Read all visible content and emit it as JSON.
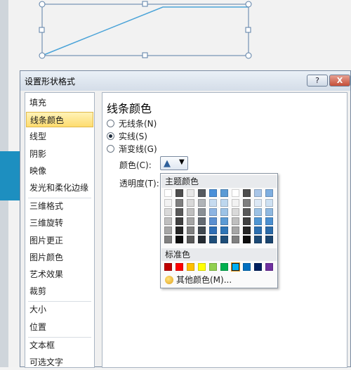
{
  "dialog": {
    "title": "设置形状格式",
    "help_label": "?",
    "close_label": "X"
  },
  "categories": [
    {
      "label": "填充"
    },
    {
      "label": "线条颜色",
      "selected": true
    },
    {
      "label": "线型"
    },
    {
      "label": "阴影"
    },
    {
      "label": "映像"
    },
    {
      "label": "发光和柔化边缘"
    },
    {
      "label": "三维格式"
    },
    {
      "label": "三维旋转"
    },
    {
      "label": "图片更正"
    },
    {
      "label": "图片颜色"
    },
    {
      "label": "艺术效果"
    },
    {
      "label": "裁剪"
    },
    {
      "label": "大小"
    },
    {
      "label": "位置"
    },
    {
      "label": "文本框"
    },
    {
      "label": "可选文字"
    }
  ],
  "panel": {
    "title": "线条颜色",
    "options": [
      {
        "label": "无线条(N)",
        "checked": false
      },
      {
        "label": "实线(S)",
        "checked": true
      },
      {
        "label": "渐变线(G)",
        "checked": false
      }
    ],
    "color_label": "颜色(C):",
    "transparency_label": "透明度(T):",
    "color_button_icon": "paint-bucket-icon"
  },
  "palette": {
    "theme_header": "主题颜色",
    "standard_header": "标准色",
    "more_colors": "其他颜色(M)...",
    "theme_colors": [
      [
        "#ffffff",
        "#000000",
        "#eeece1",
        "#1f497d",
        "#4f81bd",
        "#c0504d",
        "#9bbb59",
        "#8064a2",
        "#4bacc6",
        "#f79646"
      ]
    ],
    "theme_rows_display": [
      [
        "#ffffff",
        "#4d4d4d",
        "#e6e6e6",
        "#555a60",
        "#4a90d9",
        "#5b9bd5",
        "#ffffff",
        "#4d4d4d",
        "#a9c6e8",
        "#7eaee0"
      ],
      [
        "#f2f2f2",
        "#7f7f7f",
        "#d8d8d8",
        "#b0b4b8",
        "#c6dbf0",
        "#bdd7ee",
        "#f2f2f2",
        "#7f7f7f",
        "#dce8f5",
        "#cde0f2"
      ],
      [
        "#d9d9d9",
        "#595959",
        "#bfbfbf",
        "#8a9096",
        "#8db4e2",
        "#9dc3e6",
        "#d9d9d9",
        "#595959",
        "#9cc2e5",
        "#8eb8e0"
      ],
      [
        "#bfbfbf",
        "#404040",
        "#a5a5a5",
        "#636a72",
        "#5b8fd0",
        "#5b9bd5",
        "#bfbfbf",
        "#404040",
        "#4f96d3",
        "#4a8fd0"
      ],
      [
        "#a6a6a6",
        "#262626",
        "#7f7f7f",
        "#404850",
        "#2f6eb5",
        "#2e75b6",
        "#a6a6a6",
        "#262626",
        "#2c6fb0",
        "#2a6aa8"
      ],
      [
        "#808080",
        "#0d0d0d",
        "#595959",
        "#262c33",
        "#1f4e79",
        "#1f4e79",
        "#808080",
        "#0d0d0d",
        "#1d4a76",
        "#1a446e"
      ]
    ],
    "standard_colors": [
      "#c00000",
      "#ff0000",
      "#ffc000",
      "#ffff00",
      "#92d050",
      "#00b050",
      "#00b0f0",
      "#0070c0",
      "#002060",
      "#7030a0"
    ],
    "selected_standard_index": 6
  }
}
